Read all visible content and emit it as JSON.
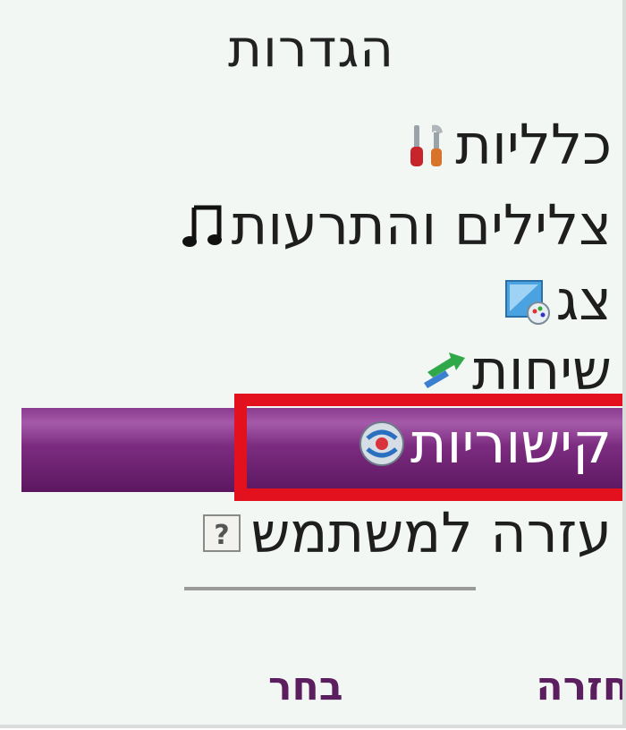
{
  "screen": {
    "title": "הגדרות"
  },
  "menu": {
    "items": [
      {
        "label": "כלליות",
        "icon": "tools-icon"
      },
      {
        "label": "צלילים והתרעות",
        "icon": "music-note-icon"
      },
      {
        "label": "צג",
        "icon": "display-icon"
      },
      {
        "label": "שיחות",
        "icon": "call-arrows-icon"
      },
      {
        "label": "קישוריות",
        "icon": "connectivity-icon",
        "selected": true
      },
      {
        "label": "עזרה למשתמש",
        "icon": "help-icon"
      }
    ]
  },
  "softkeys": {
    "select": "בחר",
    "back": "חזרה"
  },
  "colors": {
    "background": "#f3f7f4",
    "highlight": "#7c2c80",
    "annotation_frame": "#e2111d",
    "softkey_text": "#5b1e5f"
  }
}
